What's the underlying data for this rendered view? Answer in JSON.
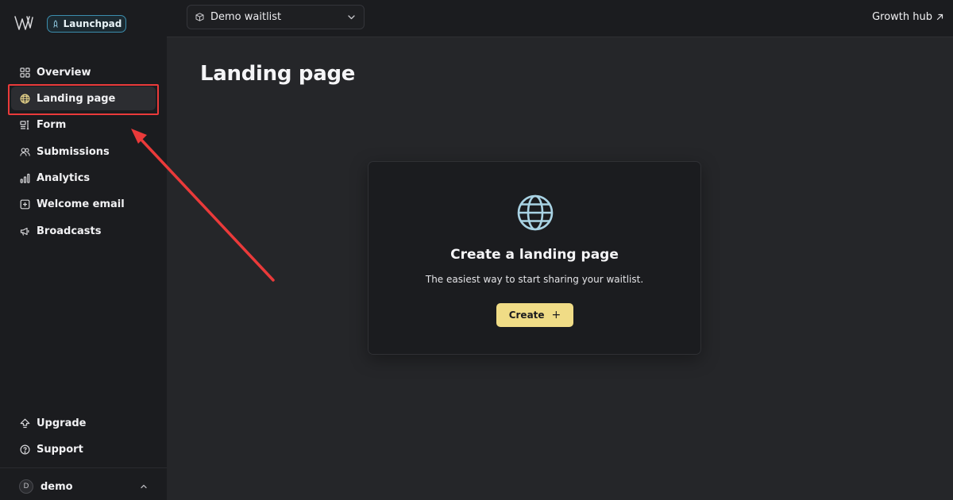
{
  "sidebar": {
    "badge_label": "Launchpad",
    "items": [
      {
        "label": "Overview",
        "icon": "grid-icon"
      },
      {
        "label": "Landing page",
        "icon": "globe-icon",
        "active": true
      },
      {
        "label": "Form",
        "icon": "form-icon"
      },
      {
        "label": "Submissions",
        "icon": "users-icon"
      },
      {
        "label": "Analytics",
        "icon": "bar-chart-icon"
      },
      {
        "label": "Welcome email",
        "icon": "plus-square-icon"
      },
      {
        "label": "Broadcasts",
        "icon": "megaphone-icon"
      }
    ],
    "bottom_items": [
      {
        "label": "Upgrade",
        "icon": "arrow-up-icon"
      },
      {
        "label": "Support",
        "icon": "help-circle-icon"
      }
    ],
    "user": {
      "initial": "D",
      "name": "demo"
    }
  },
  "topbar": {
    "waitlist_selected": "Demo waitlist",
    "growth_hub_label": "Growth hub"
  },
  "main": {
    "title": "Landing page",
    "empty_state": {
      "title": "Create a landing page",
      "subtitle": "The easiest way to start sharing your waitlist.",
      "button_label": "Create",
      "button_icon": "+"
    }
  },
  "colors": {
    "background": "#252629",
    "sidebar": "#1b1c1f",
    "accent_button": "#f0dc86",
    "badge_border": "#3c8dad",
    "annotation": "#ea3a3a"
  }
}
